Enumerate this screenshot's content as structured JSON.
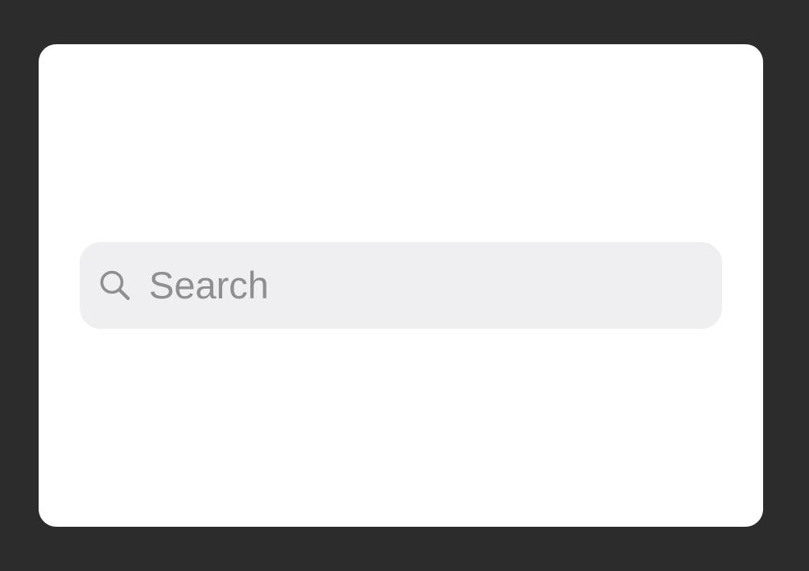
{
  "search": {
    "placeholder": "Search",
    "value": "",
    "icon": "search-icon"
  },
  "colors": {
    "backdrop": "#2c2c2c",
    "card": "#ffffff",
    "field_background": "#efeff2",
    "placeholder_text": "#8e8e93",
    "icon": "#8e8e93"
  }
}
